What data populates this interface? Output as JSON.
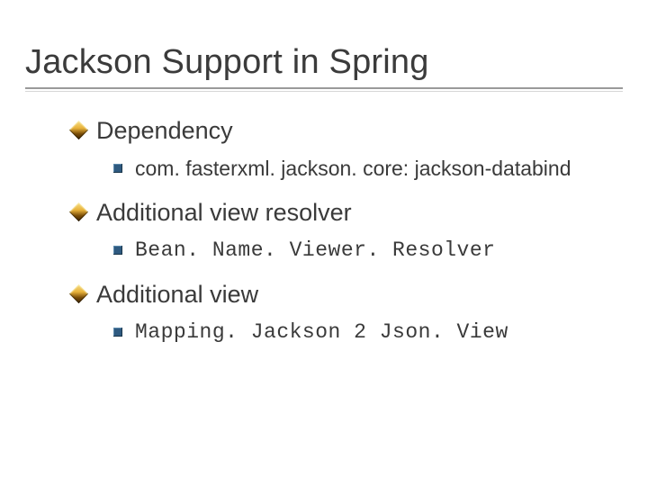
{
  "title": "Jackson Support in Spring",
  "sections": [
    {
      "heading": "Dependency",
      "items": [
        {
          "text": "com. fasterxml. jackson. core: jackson-databind",
          "mono": false
        }
      ]
    },
    {
      "heading": "Additional view resolver",
      "items": [
        {
          "text": "Bean. Name. Viewer. Resolver",
          "mono": true
        }
      ]
    },
    {
      "heading": "Additional view",
      "items": [
        {
          "text": "Mapping. Jackson 2 Json. View",
          "mono": true
        }
      ]
    }
  ]
}
